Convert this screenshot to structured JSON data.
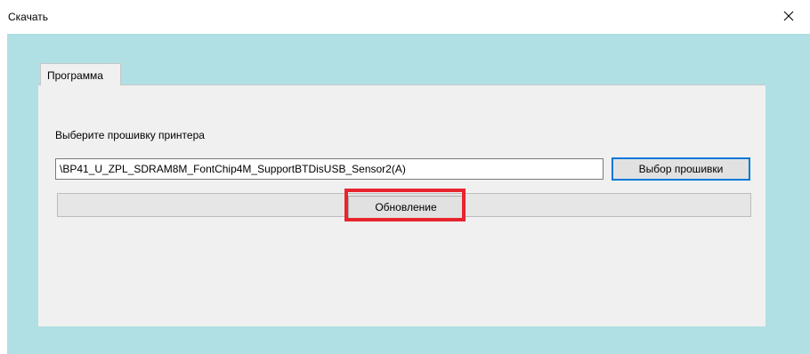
{
  "window": {
    "title": "Скачать",
    "close_icon": "close-icon"
  },
  "tabs": [
    {
      "label": "Программа",
      "active": true
    }
  ],
  "firmware": {
    "prompt_label": "Выберите прошивку принтера",
    "path_value": "\\BP41_U_ZPL_SDRAM8M_FontChip4M_SupportBTDisUSB_Sensor2(A)",
    "select_button_label": "Выбор прошивки"
  },
  "update": {
    "button_label": "Обновление",
    "progress": 0
  },
  "colors": {
    "client_background": "#b0dfe4",
    "panel_background": "#f0f0f0",
    "focus_border": "#0078d7",
    "annotation_highlight": "#e8242d"
  }
}
